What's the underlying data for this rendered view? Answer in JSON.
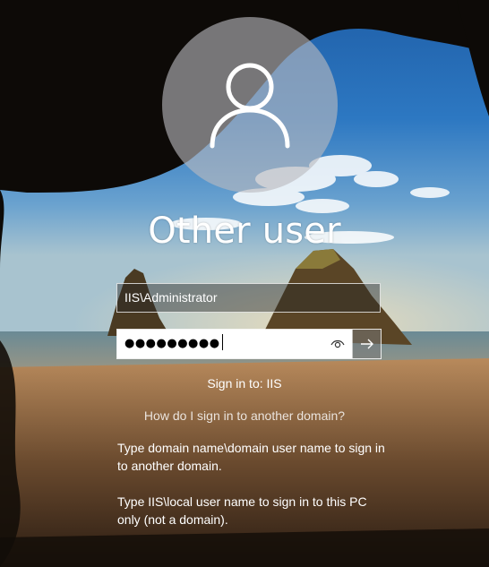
{
  "user_tile": {
    "name": "Other user",
    "avatar_icon": "user-silhouette-icon"
  },
  "username_field": {
    "value": "IIS\\Administrator"
  },
  "password_field": {
    "masked_value": "●●●●●●●●●",
    "reveal_icon": "eye-icon",
    "submit_icon": "arrow-right-icon"
  },
  "sign_in_to": "Sign in to: IIS",
  "domain_help_link": "How do I sign in to another domain?",
  "help_text": {
    "line1": "Type domain name\\domain user name to sign in to another domain.",
    "line2": "Type IIS\\local user name to sign in to this PC only (not a domain)."
  },
  "colors": {
    "text": "#ffffff",
    "avatar_bg": "#b9b9be",
    "password_bg": "#ffffff"
  }
}
